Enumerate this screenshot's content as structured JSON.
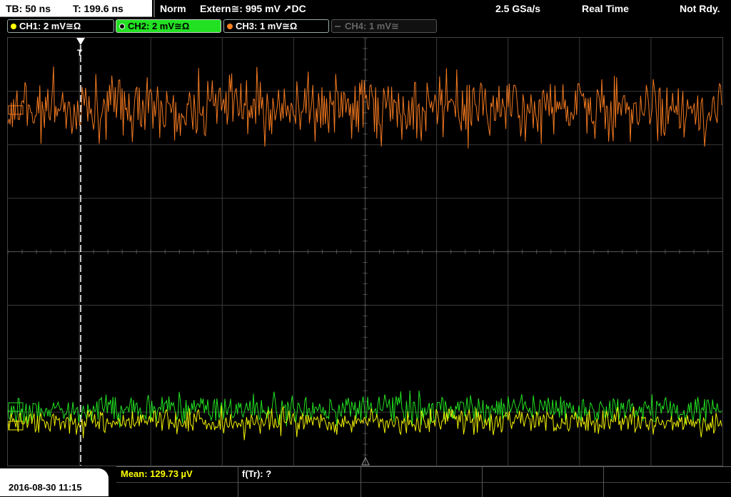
{
  "status": {
    "tb": "TB: 50 ns",
    "t": "T: 199.6 ns",
    "mode": "Norm",
    "trigger": "Extern≅: 995 mV ↗DC",
    "rate": "2.5 GSa/s",
    "acq": "Real Time",
    "ready": "Not Rdy."
  },
  "channels": [
    {
      "label": "CH1: 2 mV≅Ω",
      "color": "#ffff00",
      "active": false,
      "enabled": true
    },
    {
      "label": "CH2: 2 mV≅Ω",
      "color": "#00ff00",
      "active": true,
      "enabled": true
    },
    {
      "label": "CH3: 1 mV≅Ω",
      "color": "#ff8020",
      "active": false,
      "enabled": true
    },
    {
      "label": "CH4: 1 mV≅",
      "color": "#777777",
      "active": false,
      "enabled": false
    }
  ],
  "bottom": {
    "datetime": "2016-08-30 11:15",
    "mean": "Mean: 129.73 µV",
    "freq": "f(Tr): ?"
  },
  "colors": {
    "ch1": "#f0f000",
    "ch2": "#22e022",
    "ch3": "#f07820",
    "grid": "#3a3a3a"
  }
}
